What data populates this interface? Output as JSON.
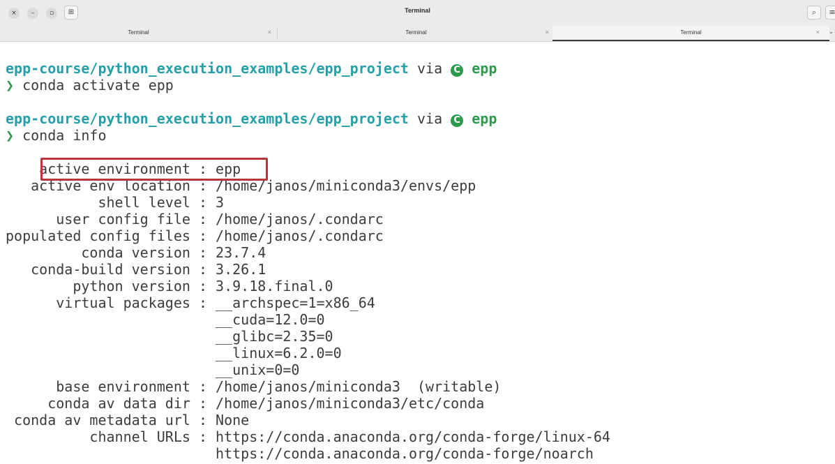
{
  "window": {
    "title": "Terminal",
    "controls": {
      "close": "×",
      "minimize": "–",
      "maximize": "▫"
    },
    "new_tab_icon": "⊞",
    "search_icon": "⌕",
    "menu_icon": "≡"
  },
  "tabs": [
    {
      "label": "Terminal",
      "close": "×",
      "active": false
    },
    {
      "label": "Terminal",
      "close": "×",
      "active": false
    },
    {
      "label": "Terminal",
      "close": "×",
      "active": true
    }
  ],
  "tab_overflow": "⌄",
  "terminal": {
    "prompt_path": "epp-course/python_execution_examples/epp_project",
    "via": " via ",
    "conda_badge": "C",
    "env_name": "epp",
    "prompt_symbol": "❯",
    "commands": [
      "conda activate epp",
      "conda info"
    ],
    "info_lines": [
      "    active environment : epp",
      "   active env location : /home/janos/miniconda3/envs/epp",
      "           shell level : 3",
      "      user config file : /home/janos/.condarc",
      "populated config files : /home/janos/.condarc",
      "         conda version : 23.7.4",
      "   conda-build version : 3.26.1",
      "        python version : 3.9.18.final.0",
      "      virtual packages : __archspec=1=x86_64",
      "                         __cuda=12.0=0",
      "                         __glibc=2.35=0",
      "                         __linux=6.2.0=0",
      "                         __unix=0=0",
      "      base environment : /home/janos/miniconda3  (writable)",
      "     conda av data dir : /home/janos/miniconda3/etc/conda",
      " conda av metadata url : None",
      "          channel URLs : https://conda.anaconda.org/conda-forge/linux-64",
      "                         https://conda.anaconda.org/conda-forge/noarch"
    ]
  },
  "colors": {
    "path": "#26a0a7",
    "env": "#2e9a4e",
    "highlight": "#b8353a"
  }
}
